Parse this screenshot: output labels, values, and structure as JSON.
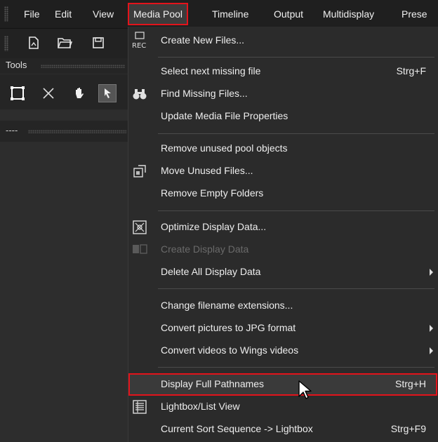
{
  "menubar": {
    "items": [
      "File",
      "Edit",
      "View",
      "Media Pool",
      "Timeline",
      "Output",
      "Multidisplay",
      "Prese"
    ],
    "active_index": 3
  },
  "toolbar": {
    "icons": [
      "new-file-icon",
      "open-folder-icon",
      "save-icon"
    ]
  },
  "tools_panel": {
    "title": "Tools",
    "tool_icons": [
      "selection-icon",
      "scissors-icon",
      "hand-icon",
      "pointer-tool-icon"
    ],
    "dash_text": "----"
  },
  "dropdown": {
    "items": [
      {
        "label": "Create New Files...",
        "shortcut": "",
        "icon": "rec-icon",
        "submenu": false,
        "disabled": false
      },
      {
        "label": "Select next missing file",
        "shortcut": "Strg+F",
        "icon": "",
        "submenu": false,
        "disabled": false
      },
      {
        "label": "Find Missing Files...",
        "shortcut": "",
        "icon": "binoculars-icon",
        "submenu": false,
        "disabled": false
      },
      {
        "label": "Update Media File Properties",
        "shortcut": "",
        "icon": "",
        "submenu": false,
        "disabled": false
      },
      {
        "label": "Remove unused pool objects",
        "shortcut": "",
        "icon": "",
        "submenu": false,
        "disabled": false
      },
      {
        "label": "Move Unused Files...",
        "shortcut": "",
        "icon": "move-files-icon",
        "submenu": false,
        "disabled": false
      },
      {
        "label": "Remove Empty Folders",
        "shortcut": "",
        "icon": "",
        "submenu": false,
        "disabled": false
      },
      {
        "label": "Optimize Display Data...",
        "shortcut": "",
        "icon": "optimize-icon",
        "submenu": false,
        "disabled": false
      },
      {
        "label": "Create Display Data",
        "shortcut": "",
        "icon": "create-display-data-icon",
        "submenu": false,
        "disabled": true
      },
      {
        "label": "Delete All Display Data",
        "shortcut": "",
        "icon": "",
        "submenu": true,
        "disabled": false
      },
      {
        "label": "Change filename extensions...",
        "shortcut": "",
        "icon": "",
        "submenu": false,
        "disabled": false
      },
      {
        "label": "Convert pictures to JPG format",
        "shortcut": "",
        "icon": "",
        "submenu": true,
        "disabled": false
      },
      {
        "label": "Convert videos to Wings videos",
        "shortcut": "",
        "icon": "",
        "submenu": true,
        "disabled": false
      },
      {
        "label": "Display Full Pathnames",
        "shortcut": "Strg+H",
        "icon": "",
        "submenu": false,
        "disabled": false
      },
      {
        "label": "Lightbox/List View",
        "shortcut": "",
        "icon": "list-view-icon",
        "submenu": false,
        "disabled": false
      },
      {
        "label": "Current Sort Sequence -> Lightbox",
        "shortcut": "Strg+F9",
        "icon": "",
        "submenu": false,
        "disabled": false
      }
    ],
    "highlight_index": 13
  },
  "colors": {
    "highlight_border": "#e3131b",
    "menu_bg": "#2b2b2b",
    "menubar_bg": "#1f1f1f",
    "text": "#eeeeee",
    "disabled_text": "#6a6a6a"
  }
}
